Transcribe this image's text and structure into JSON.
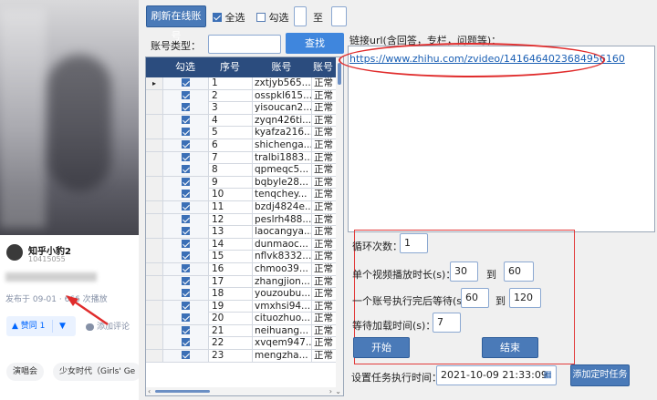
{
  "zhihu": {
    "author_name": "知乎小豹2",
    "author_id": "10415055",
    "meta": "发布于 09-01 · 666 次播放",
    "vote_label": "▲ 赞同 1",
    "vote_down": "▼",
    "comment_label": "添加评论",
    "tags": [
      "演唱会",
      "少女时代（Girls' Ge"
    ]
  },
  "toolbar": {
    "refresh_label": "刷新在线账号",
    "select_all_label": "全选",
    "check_label": "勾选",
    "to_label": "至"
  },
  "search": {
    "type_label": "账号类型：",
    "button_label": "查找"
  },
  "grid": {
    "columns": [
      "勾选",
      "序号",
      "账号",
      "账号"
    ],
    "rows": [
      {
        "no": "1",
        "account": "zxtjyb565...",
        "status": "正常"
      },
      {
        "no": "2",
        "account": "osspkl615...",
        "status": "正常"
      },
      {
        "no": "3",
        "account": "yisoucan2...",
        "status": "正常"
      },
      {
        "no": "4",
        "account": "zyqn426ti...",
        "status": "正常"
      },
      {
        "no": "5",
        "account": "kyafza216...",
        "status": "正常"
      },
      {
        "no": "6",
        "account": "shichenga...",
        "status": "正常"
      },
      {
        "no": "7",
        "account": "tralbi1883...",
        "status": "正常"
      },
      {
        "no": "8",
        "account": "qpmeqc5...",
        "status": "正常"
      },
      {
        "no": "9",
        "account": "bqbyle28...",
        "status": "正常"
      },
      {
        "no": "10",
        "account": "tenqchey...",
        "status": "正常"
      },
      {
        "no": "11",
        "account": "bzdj4824e...",
        "status": "正常"
      },
      {
        "no": "12",
        "account": "peslrh488...",
        "status": "正常"
      },
      {
        "no": "13",
        "account": "laocangya...",
        "status": "正常"
      },
      {
        "no": "14",
        "account": "dunmaoc...",
        "status": "正常"
      },
      {
        "no": "15",
        "account": "nflvk8332...",
        "status": "正常"
      },
      {
        "no": "16",
        "account": "chmoo39...",
        "status": "正常"
      },
      {
        "no": "17",
        "account": "zhangjion...",
        "status": "正常"
      },
      {
        "no": "18",
        "account": "youzoubu...",
        "status": "正常"
      },
      {
        "no": "19",
        "account": "vmxhsi94...",
        "status": "正常"
      },
      {
        "no": "20",
        "account": "cituozhuo...",
        "status": "正常"
      },
      {
        "no": "21",
        "account": "neihuang...",
        "status": "正常"
      },
      {
        "no": "22",
        "account": "xvqem947...",
        "status": "正常"
      },
      {
        "no": "23",
        "account": "mengzha...",
        "status": "正常"
      }
    ]
  },
  "url_section": {
    "label": "链接url(含回答，专栏，问题等)：",
    "value": "https://www.zhihu.com/zvideo/1416464023684956160"
  },
  "settings": {
    "loop_label": "循环次数：",
    "loop_value": "1",
    "play_label": "单个视频播放时长(s)：",
    "play_min": "30",
    "play_to": "到",
    "play_max": "60",
    "wait_label": "一个账号执行完后等待(s)",
    "wait_min": "60",
    "wait_to": "到",
    "wait_max": "120",
    "load_label": "等待加载时间(s)：",
    "load_value": "7",
    "start_label": "开始",
    "stop_label": "结束"
  },
  "schedule": {
    "label": "设置任务执行时间：",
    "datetime": "2021-10-09 21:33:09",
    "add_label": "添加定时任务"
  },
  "colors": {
    "header": "#2b4c7e",
    "button": "#4a7ab8",
    "annotation": "#e02c2c"
  }
}
